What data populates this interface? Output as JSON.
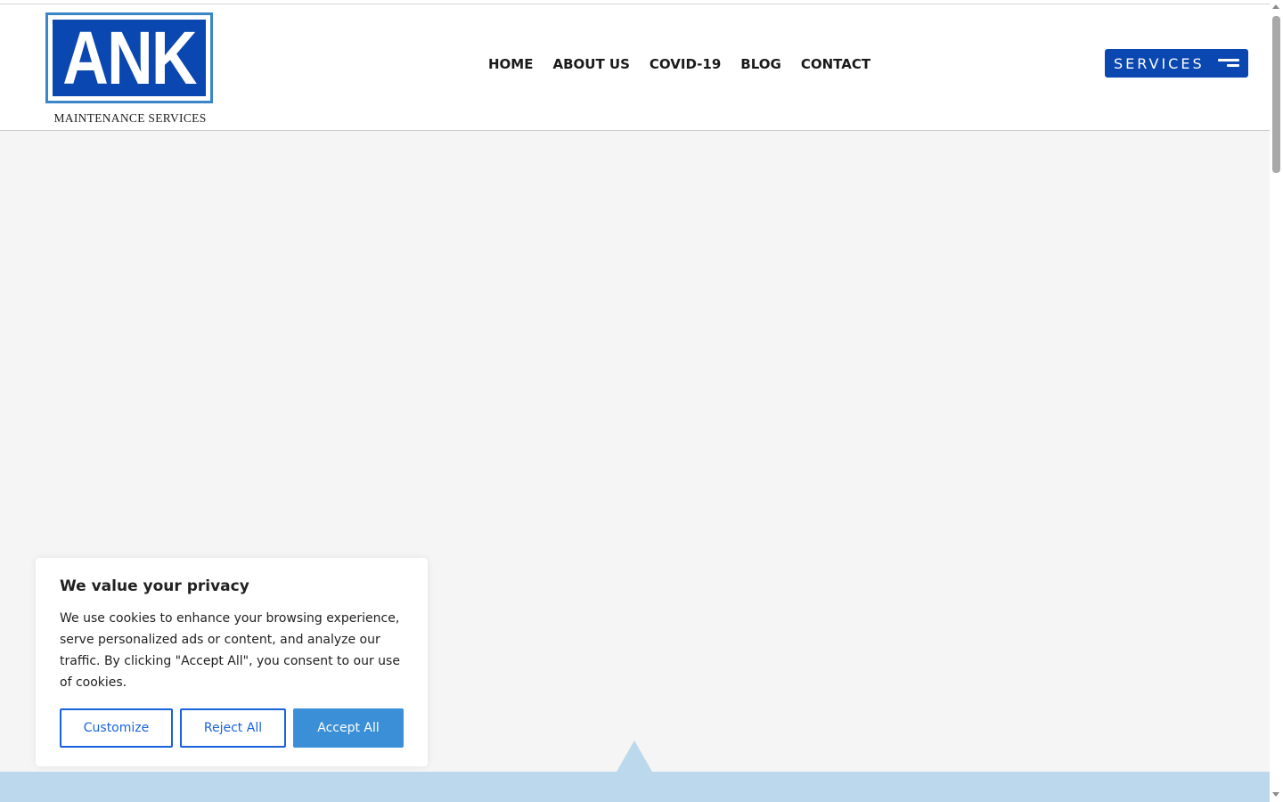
{
  "brand": {
    "logo_text": "ANK",
    "tagline": "MAINTENANCE SERVICES"
  },
  "nav": {
    "items": [
      {
        "label": "HOME"
      },
      {
        "label": "ABOUT US"
      },
      {
        "label": "COVID-19"
      },
      {
        "label": "BLOG"
      },
      {
        "label": "CONTACT"
      }
    ]
  },
  "services_button": {
    "label": "SERVICES"
  },
  "cookie_banner": {
    "title": "We value your privacy",
    "body": "We use cookies to enhance your browsing experience, serve personalized ads or content, and analyze our traffic. By clicking \"Accept All\", you consent to our use of cookies.",
    "customize_label": "Customize",
    "reject_label": "Reject All",
    "accept_label": "Accept All"
  },
  "colors": {
    "brand_blue": "#0a47b0",
    "logo_border": "#3b86c9",
    "accept_blue": "#3a8fd6",
    "outline_blue": "#1863dc",
    "band_light_blue": "#bcd8ec",
    "page_bg": "#f5f5f5"
  }
}
